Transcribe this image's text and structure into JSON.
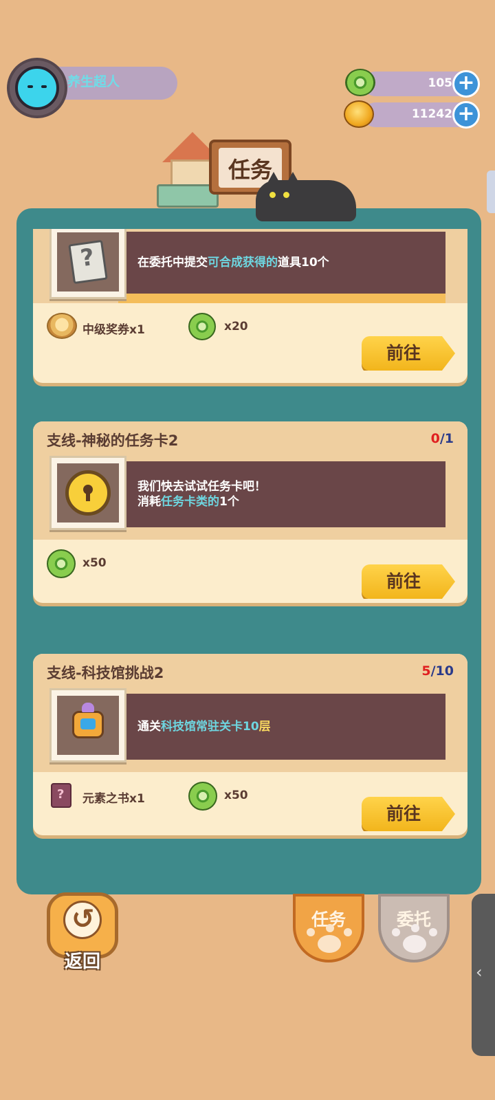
{
  "player": {
    "name": "养生超人"
  },
  "currencies": [
    {
      "type": "green-coin",
      "value": "105"
    },
    {
      "type": "gold-coin",
      "value": "11242"
    }
  ],
  "panel": {
    "title": "任务"
  },
  "tasks": [
    {
      "title": "",
      "progress_current": "",
      "progress_total": "",
      "desc_line1_pre": "在委托中提交",
      "desc_line1_hl": "可合成获得的",
      "desc_line1_post": "道具10个",
      "desc_line2_pre": "",
      "desc_line2_hl": "",
      "desc_line2_post": "",
      "icon": "mystery-card-icon",
      "rewards": [
        {
          "icon": "ticket-icon",
          "label": "中级奖券x1"
        },
        {
          "icon": "green-coin-icon",
          "label": "x20"
        }
      ],
      "button": "前往"
    },
    {
      "title": "支线-神秘的任务卡2",
      "progress_current": "0",
      "progress_total": "/1",
      "desc_line1_pre": "我们快去试试任务卡吧！",
      "desc_line1_hl": "",
      "desc_line1_post": "",
      "desc_line2_pre": "消耗",
      "desc_line2_hl": "任务卡类的",
      "desc_line2_post": "1个",
      "icon": "lock-coin-icon",
      "rewards": [
        {
          "icon": "green-coin-icon",
          "label": "x50"
        }
      ],
      "button": "前往"
    },
    {
      "title": "支线-科技馆挑战2",
      "progress_current": "5",
      "progress_total": "/10",
      "desc_line1_pre": "通关",
      "desc_line1_hl": "科技馆常驻关卡10",
      "desc_line1_post": "层",
      "desc_line2_pre": "",
      "desc_line2_hl": "",
      "desc_line2_post": "",
      "icon": "robot-icon",
      "rewards": [
        {
          "icon": "element-book-icon",
          "label": "元素之书x1"
        },
        {
          "icon": "green-coin-icon",
          "label": "x50"
        }
      ],
      "button": "前往"
    }
  ],
  "bottom": {
    "back_label": "返回",
    "tab_tasks": "任务",
    "tab_commission": "委托",
    "side_chevron": "‹"
  },
  "colors": {
    "background": "#e8b887",
    "panel": "#3e8a8b",
    "card": "#fcedcc",
    "desc_box": "#6a4648",
    "highlight": "#6ed6e0",
    "progress_current": "#e02020",
    "button": "#f2b51c"
  }
}
